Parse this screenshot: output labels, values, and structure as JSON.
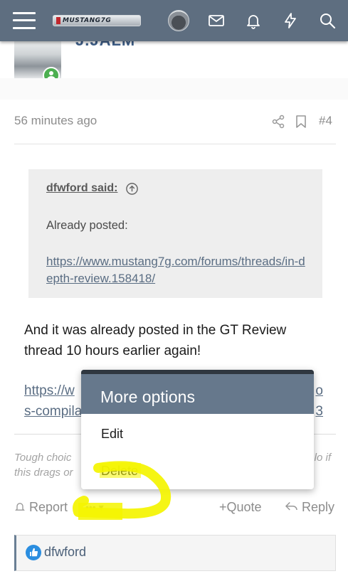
{
  "header": {
    "logo_text": "MUSTANG7G",
    "icons": [
      "menu-icon",
      "car-avatar-icon",
      "inbox-icon",
      "bell-icon",
      "bolt-icon",
      "search-icon"
    ]
  },
  "user": {
    "name": "J.JALM"
  },
  "post": {
    "time": "56 minutes ago",
    "number": "#4",
    "quote": {
      "author": "dfwford said:",
      "text": "Already posted:",
      "link": "https://www.mustang7g.com/forums/threads/in-depth-review.158418/"
    },
    "body": "And it was already posted in the GT Review thread 10 hours earlier again!",
    "link_start": "https://w",
    "link_end": "o",
    "link2_start": "s-compila",
    "link2_end": "3",
    "signature_start": "Tough choic",
    "signature_end": "lo if",
    "signature2_start": "this drags or"
  },
  "actions": {
    "report": "Report",
    "more": "•••",
    "quote": "Quote",
    "reply": "Reply"
  },
  "reactions": {
    "user": "dfwford"
  },
  "popup": {
    "title": "More options",
    "items": [
      "Edit",
      "Delete"
    ]
  },
  "colors": {
    "header": "#5e6e80",
    "popup_header": "#66788c",
    "link": "#5a6d83",
    "highlight": "#f4f400"
  }
}
